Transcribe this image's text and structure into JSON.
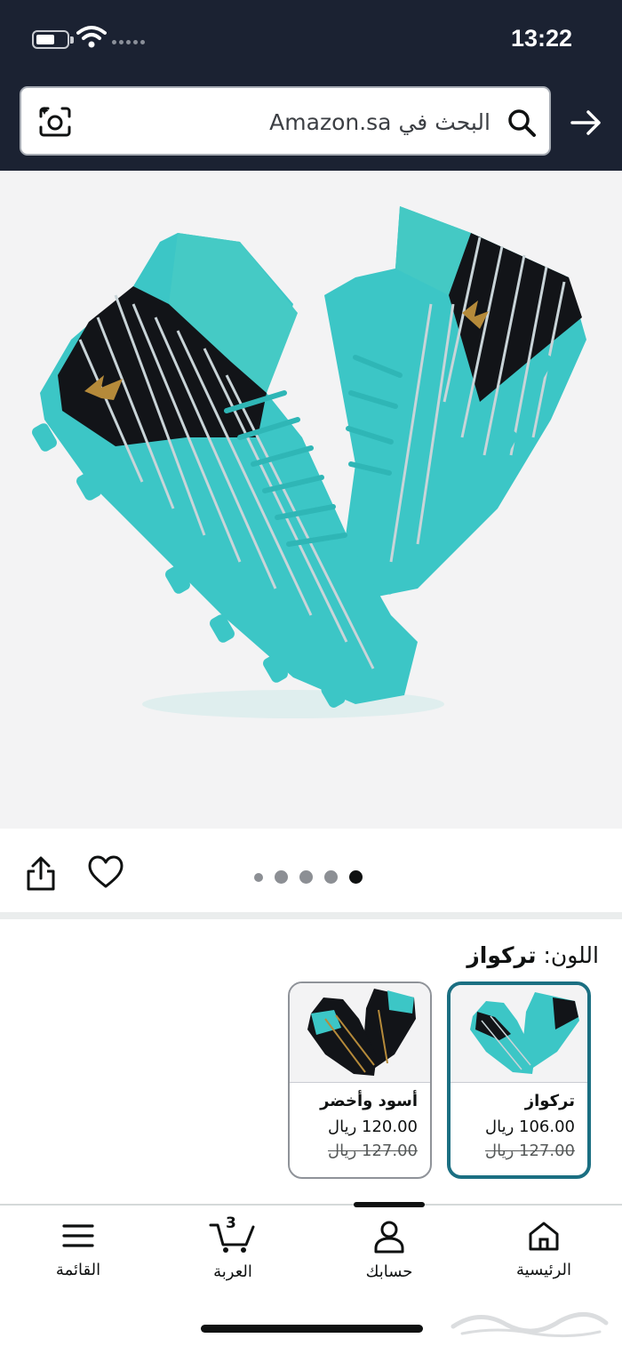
{
  "status_bar": {
    "time": "13:22"
  },
  "search": {
    "placeholder": "البحث في Amazon.sa"
  },
  "gallery": {
    "image_count": 5,
    "active_index": 4
  },
  "color": {
    "label": "اللون:",
    "selected_value": "تركواز"
  },
  "swatches": [
    {
      "name": "تركواز",
      "price": "106.00 ريال",
      "old_price": "127.00 ريال",
      "selected": true
    },
    {
      "name": "أسود وأخضر",
      "price": "120.00 ريال",
      "old_price": "127.00 ريال",
      "selected": false
    }
  ],
  "bottom_nav": {
    "home": "الرئيسية",
    "account": "حسابك",
    "cart": "العربة",
    "cart_count": "3",
    "menu": "القائمة"
  },
  "colors": {
    "header_bg": "#1b2232",
    "accent_teal": "#1b6f82",
    "shoe_teal": "#3cc6c6"
  }
}
